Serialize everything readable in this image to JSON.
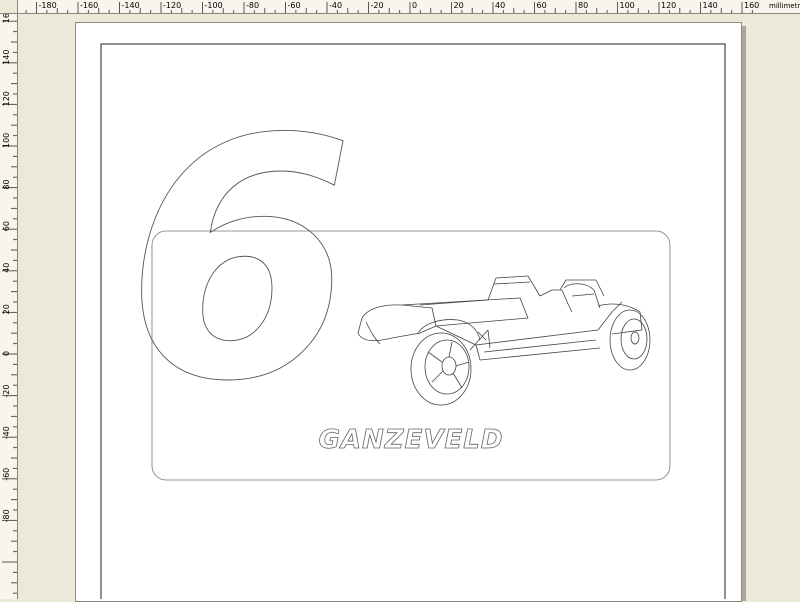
{
  "ruler": {
    "unit_label": "millimetres",
    "top_labels": [
      "-180",
      "-160",
      "-140",
      "-120",
      "-100",
      "-80",
      "-60",
      "-40",
      "-20",
      "0",
      "20",
      "40",
      "60",
      "80",
      "100",
      "120",
      "140",
      "160"
    ],
    "left_labels": [
      "160",
      "140",
      "120",
      "100",
      "80",
      "60",
      "40",
      "20",
      "0",
      "-20",
      "-40",
      "-60",
      "-80"
    ]
  },
  "artwork": {
    "race_number": "6",
    "name_text": "GANZEVELD"
  },
  "colors": {
    "workspace": "#ece9d8",
    "page": "#ffffff",
    "outline": "#555555"
  }
}
